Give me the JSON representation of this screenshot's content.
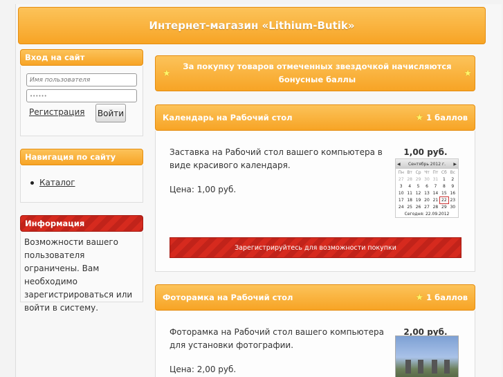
{
  "header": {
    "title": "Интернет-магазин «Lithium-Butik»"
  },
  "login": {
    "title": "Вход на сайт",
    "username_placeholder": "Имя пользователя",
    "password_value": "••••••",
    "register_label": "Регистрация",
    "login_label": "Войти"
  },
  "nav": {
    "title": "Навигация по сайту",
    "items": [
      {
        "label": "Каталог"
      }
    ]
  },
  "info": {
    "title": "Информация",
    "text": "Возможности вашего пользователя ограничены. Вам необходимо зарегистрироваться или войти в систему."
  },
  "notice": {
    "text": "За покупку товаров отмеченных звездочкой начисляются бонусные баллы"
  },
  "products": [
    {
      "title": "Календарь на Рабочий стол",
      "bonus": "1 баллов",
      "description": "Заставка на Рабочий стол вашего компьютера в виде красивого календаря.",
      "price_line": "Цена: 1,00 руб.",
      "price": "1,00 руб.",
      "register_label": "Зарегистрируйтесь для возможности покупки",
      "calendar": {
        "month": "Сентябрь 2012 г.",
        "days": [
          "Пн",
          "Вт",
          "Ср",
          "Чт",
          "Пт",
          "Сб",
          "Вс"
        ],
        "dates": [
          "27",
          "28",
          "29",
          "30",
          "31",
          "1",
          "2",
          "3",
          "4",
          "5",
          "6",
          "7",
          "8",
          "9",
          "10",
          "11",
          "12",
          "13",
          "14",
          "15",
          "16",
          "17",
          "18",
          "19",
          "20",
          "21",
          "22",
          "23",
          "24",
          "25",
          "26",
          "27",
          "28",
          "29",
          "30"
        ],
        "footer": "Сегодня: 22.09.2012"
      }
    },
    {
      "title": "Фоторамка на Рабочий стол",
      "bonus": "1 баллов",
      "description": "Фоторамка на Рабочий стол вашего компьютера для установки фотографии.",
      "price_line": "Цена: 2,00 руб.",
      "price": "2,00 руб."
    }
  ],
  "colors": {
    "accent": "#f7a425",
    "danger": "#d62a1e"
  }
}
